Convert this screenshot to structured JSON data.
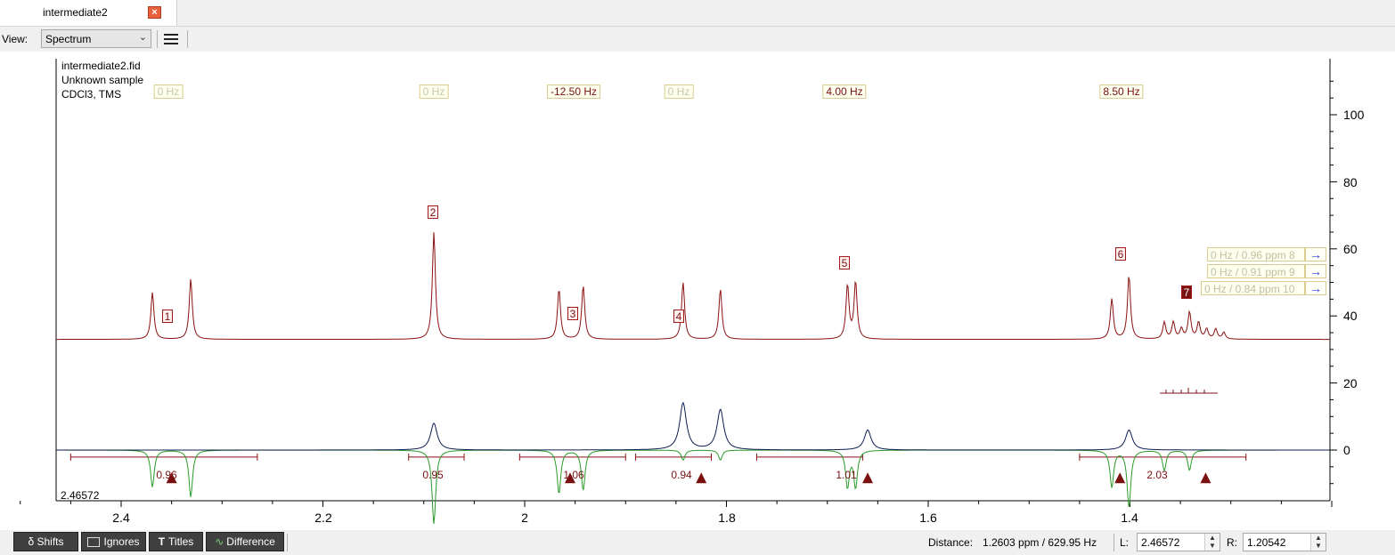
{
  "tab": {
    "title": "intermediate2",
    "close_icon": "close-icon"
  },
  "toolbar": {
    "view_label": "View:",
    "view_value": "Spectrum",
    "menu_icon": "hamburger-menu-icon"
  },
  "spectrum": {
    "header": [
      "intermediate2.fid",
      "Unknown sample",
      "CDCl3, TMS"
    ],
    "couplings": [
      "0 Hz",
      "0 Hz",
      "-12.50 Hz",
      "0 Hz",
      "4.00 Hz",
      "8.50 Hz"
    ],
    "peak_labels": [
      "1",
      "2",
      "3",
      "4",
      "5",
      "6",
      "7"
    ],
    "shift_boxes": [
      "0 Hz / 0.96 ppm 8",
      "0 Hz / 0.91 ppm 9",
      "0 Hz / 0.84 ppm 10"
    ],
    "integrals": [
      "0.96",
      "0.95",
      "1.06",
      "0.94",
      "1.01",
      "2.03"
    ],
    "cursor_value": "2.46572",
    "y_ticks": [
      "100",
      "80",
      "60",
      "40",
      "20",
      "0"
    ],
    "x_ticks": [
      "2.4",
      "2.2",
      "2",
      "1.8",
      "1.6",
      "1.4"
    ]
  },
  "chart_data": {
    "type": "line",
    "xlabel": "",
    "ylabel": "",
    "xlim": [
      2.53,
      1.15
    ],
    "ylim": [
      -20,
      115
    ],
    "x_ticks": [
      2.4,
      2.2,
      2.0,
      1.8,
      1.6,
      1.4
    ],
    "y_ticks": [
      0,
      20,
      40,
      60,
      80,
      100
    ],
    "series": [
      {
        "peaks_ppm": [
          2.369,
          2.331,
          2.09,
          1.966,
          1.942,
          1.843,
          1.806,
          1.68,
          1.672,
          1.418,
          1.401,
          1.366,
          1.357,
          1.349,
          1.341,
          1.332,
          1.324,
          1.315,
          1.307
        ],
        "peak_heights": [
          47,
          51,
          65,
          48,
          49,
          50,
          48,
          49,
          50,
          45,
          52,
          38,
          38,
          36,
          41,
          38,
          36,
          36,
          35
        ],
        "baseline": 33
      },
      {
        "peaks_ppm": [
          2.09,
          1.843,
          1.806,
          1.66,
          1.401
        ],
        "peak_heights": [
          8,
          14,
          12,
          6,
          6
        ],
        "baseline": 0
      },
      {
        "peaks_ppm": [
          2.369,
          2.331,
          2.09,
          1.966,
          1.942,
          1.843,
          1.806,
          1.68,
          1.672,
          1.418,
          1.401,
          1.366,
          1.341
        ],
        "peak_heights": [
          -11,
          -14,
          -22,
          -13,
          -12,
          -3,
          -3,
          -11,
          -11,
          -11,
          -17,
          -6,
          -6
        ],
        "baseline": 0
      }
    ],
    "integrals": [
      {
        "from": 2.45,
        "to": 2.265,
        "value": 0.96
      },
      {
        "from": 2.115,
        "to": 2.06,
        "value": 0.95
      },
      {
        "from": 2.005,
        "to": 1.9,
        "value": 1.06
      },
      {
        "from": 1.89,
        "to": 1.815,
        "value": 0.94
      },
      {
        "from": 1.77,
        "to": 1.665,
        "value": 1.01
      },
      {
        "from": 1.45,
        "to": 1.285,
        "value": 2.03
      }
    ],
    "markers_ppm": [
      2.35,
      1.955,
      1.825,
      1.66,
      1.41,
      1.325
    ]
  },
  "bottombar": {
    "shifts_label": "δ Shifts",
    "ignores_label": "Ignores",
    "titles_label": "Titles",
    "difference_label": "Difference",
    "distance_label": "Distance:",
    "distance_value": "1.2603 ppm / 629.95 Hz",
    "l_label": "L:",
    "l_value": "2.46572",
    "r_label": "R:",
    "r_value": "1.20542"
  }
}
